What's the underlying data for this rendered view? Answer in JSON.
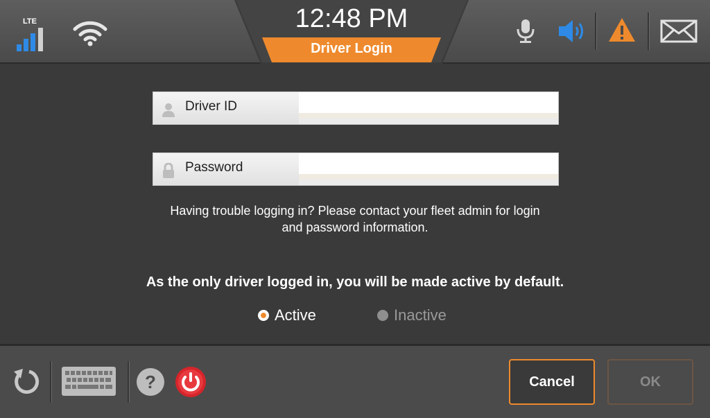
{
  "status_bar": {
    "network_type": "LTE",
    "signal_icon": "signal-bars-icon",
    "wifi_icon": "wifi-icon",
    "time": "12:48 PM",
    "screen_title": "Driver Login",
    "mic_icon": "microphone-icon",
    "speaker_icon": "speaker-icon",
    "alert_icon": "warning-icon",
    "mail_icon": "mail-icon"
  },
  "form": {
    "driver_id": {
      "label": "Driver ID",
      "value": "",
      "icon": "user-icon"
    },
    "password": {
      "label": "Password",
      "value": "",
      "icon": "lock-icon"
    },
    "help_line1": "Having trouble logging in? Please contact your fleet admin for login",
    "help_line2": "and password information.",
    "active_message": "As the only driver logged in, you will be made active by default.",
    "status_options": [
      {
        "label": "Active",
        "selected": true,
        "enabled": true
      },
      {
        "label": "Inactive",
        "selected": false,
        "enabled": false
      }
    ]
  },
  "toolbar": {
    "refresh_icon": "refresh-icon",
    "keyboard_icon": "keyboard-icon",
    "help_icon": "help-icon",
    "power_icon": "power-icon",
    "cancel_label": "Cancel",
    "ok_label": "OK"
  },
  "colors": {
    "accent_orange": "#ee8a2d",
    "signal_blue": "#2e8ae6",
    "power_red": "#d5252b",
    "background": "#3a3a3a"
  }
}
